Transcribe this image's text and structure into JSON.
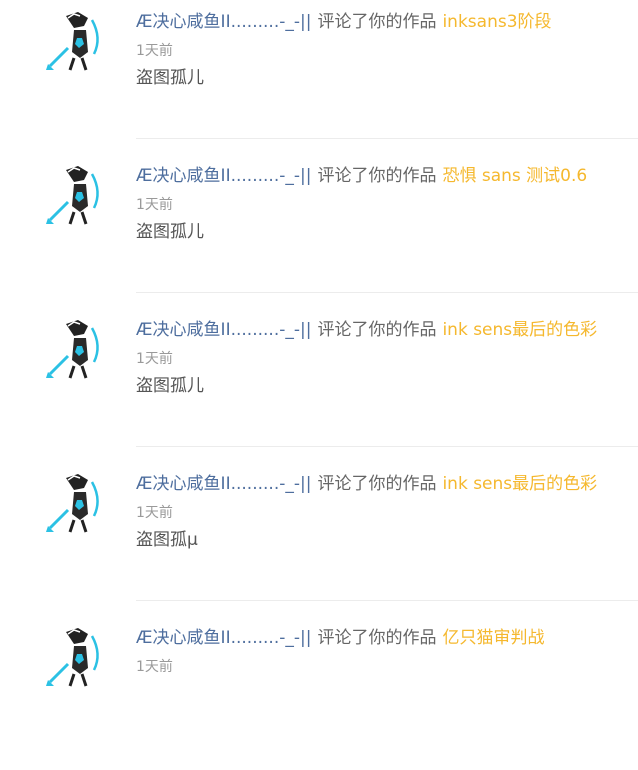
{
  "feed": {
    "items": [
      {
        "user": "Æ决心咸鱼ІІ.........-_-||",
        "action": "评论了你的作品",
        "work": "inksans3阶段",
        "time": "1天前",
        "comment": "盗图孤儿"
      },
      {
        "user": "Æ决心咸鱼ІІ.........-_-||",
        "action": "评论了你的作品",
        "work": "恐惧 sans 测试0.6",
        "time": "1天前",
        "comment": "盗图孤儿"
      },
      {
        "user": "Æ决心咸鱼ІІ.........-_-||",
        "action": "评论了你的作品",
        "work": "ink sens最后的色彩",
        "time": "1天前",
        "comment": "盗图孤儿"
      },
      {
        "user": "Æ决心咸鱼ІІ.........-_-||",
        "action": "评论了你的作品",
        "work": "ink sens最后的色彩",
        "time": "1天前",
        "comment": "盗图孤µ"
      },
      {
        "user": "Æ决心咸鱼ІІ.........-_-||",
        "action": "评论了你的作品",
        "work": "亿只猫审判战",
        "time": "1天前",
        "comment": ""
      }
    ]
  },
  "colors": {
    "user": "#4e6e9e",
    "work": "#f5b82e",
    "avatar_accent": "#2bc1e4"
  },
  "icons": {
    "avatar": "sans-character-avatar-icon"
  }
}
